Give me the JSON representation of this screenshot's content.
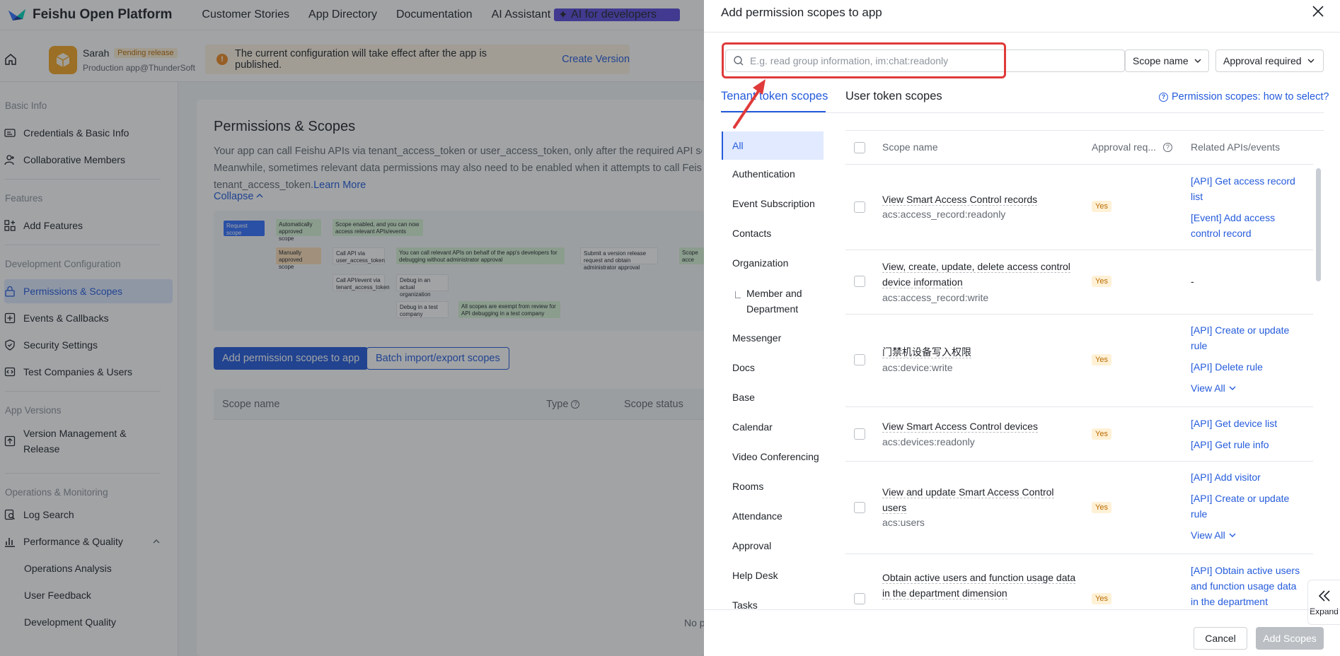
{
  "topnav": {
    "brand": "Feishu Open Platform",
    "links": [
      "Customer Stories",
      "App Directory",
      "Documentation",
      "AI Assistant"
    ],
    "ai_badge": "AI for developers"
  },
  "appbar": {
    "app_name": "Sarah",
    "app_status": "Pending release",
    "app_sub": "Production app@ThunderSoft",
    "notice_text": "The current configuration will take effect after the app is published.",
    "notice_link": "Create Version"
  },
  "sidebar": {
    "sections": {
      "basic": "Basic Info",
      "features": "Features",
      "dev": "Development Configuration",
      "versions": "App Versions",
      "ops": "Operations & Monitoring"
    },
    "items": {
      "credentials": "Credentials & Basic Info",
      "members": "Collaborative Members",
      "add_features": "Add Features",
      "permissions": "Permissions & Scopes",
      "events": "Events & Callbacks",
      "security": "Security Settings",
      "test_companies": "Test Companies & Users",
      "version_mgmt_1": "Version Management &",
      "version_mgmt_2": "Release",
      "log_search": "Log Search",
      "performance": "Performance & Quality",
      "ops_analysis": "Operations Analysis",
      "user_feedback": "User Feedback",
      "dev_quality": "Development Quality"
    }
  },
  "main": {
    "title": "Permissions & Scopes",
    "desc_line1": "Your app can call Feishu APIs via tenant_access_token or user_access_token, only after the required API scopes",
    "desc_line2": "Meanwhile, sometimes relevant data permissions may also need to be enabled when it attempts to call Feishu A",
    "desc_line3": "tenant_access_token.",
    "learn_more": "Learn More",
    "collapse": "Collapse",
    "diagram": {
      "request": "Request scope",
      "auto": "Automatically approved scope",
      "enabled": "Scope enabled, and you can now access relevant APIs/events",
      "manual": "Manually approved scope",
      "call_user": "Call API via user_access_token",
      "call_user_desc": "You can call relevant APIs on behalf of the app's developers for debugging without administrator approval",
      "submit": "Submit a version release request and obtain administrator approval",
      "scope_cut": "Scope",
      "access_cut": "acce",
      "call_tenant": "Call API/event via tenant_access_token",
      "debug_actual": "Debug in an actual organization",
      "debug_test": "Debug in a test company",
      "exempt": "All scopes are exempt from review for API debugging in a test company"
    },
    "btn_add": "Add permission scopes to app",
    "btn_batch": "Batch import/export scopes",
    "cols": {
      "scope": "Scope name",
      "type": "Type",
      "status": "Scope status"
    },
    "no_p": "No p"
  },
  "drawer": {
    "title": "Add permission scopes to app",
    "search_placeholder": "E.g. read group information, im:chat:readonly",
    "filter_scope": "Scope name",
    "filter_approval": "Approval required",
    "tab_tenant": "Tenant token scopes",
    "tab_user": "User token scopes",
    "help": "Permission scopes: how to select?",
    "categories": [
      "All",
      "Authentication",
      "Event Subscription",
      "Contacts",
      "Organization",
      "Member and",
      "Department",
      "Messenger",
      "Docs",
      "Base",
      "Calendar",
      "Video Conferencing",
      "Rooms",
      "Attendance",
      "Approval",
      "Help Desk",
      "Tasks"
    ],
    "cols": {
      "name": "Scope name",
      "approval": "Approval req...",
      "apis": "Related APIs/events"
    },
    "rows": [
      {
        "name": "View Smart Access Control records",
        "key": "acs:access_record:readonly",
        "yes": "Yes",
        "apis": [
          "[API] Get access record",
          "list",
          "[Event] Add access",
          "control record"
        ]
      },
      {
        "name1": "View, create, update, delete access control",
        "name2": "device information",
        "key": "acs:access_record:write",
        "yes": "Yes",
        "apis": "-"
      },
      {
        "name": "门禁机设备写入权限",
        "key": "acs:device:write",
        "yes": "Yes",
        "apis": [
          "[API] Create or update",
          "rule",
          "[API] Delete rule",
          "View All"
        ]
      },
      {
        "name": "View Smart Access Control devices",
        "key": "acs:devices:readonly",
        "yes": "Yes",
        "apis": [
          "[API] Get device list",
          "[API] Get rule info"
        ]
      },
      {
        "name1": "View and update Smart Access Control",
        "name2": "users",
        "key": "acs:users",
        "yes": "Yes",
        "apis": [
          "[API] Add visitor",
          "[API] Create or update",
          "rule",
          "View All"
        ]
      },
      {
        "name1": "Obtain active users and function usage data",
        "name2": "in the department dimension",
        "yes": "Yes",
        "apis": [
          "[API] Obtain active users",
          "and function usage data",
          "in the department"
        ]
      }
    ],
    "expand": "Expand",
    "cancel": "Cancel",
    "add": "Add Scopes"
  }
}
